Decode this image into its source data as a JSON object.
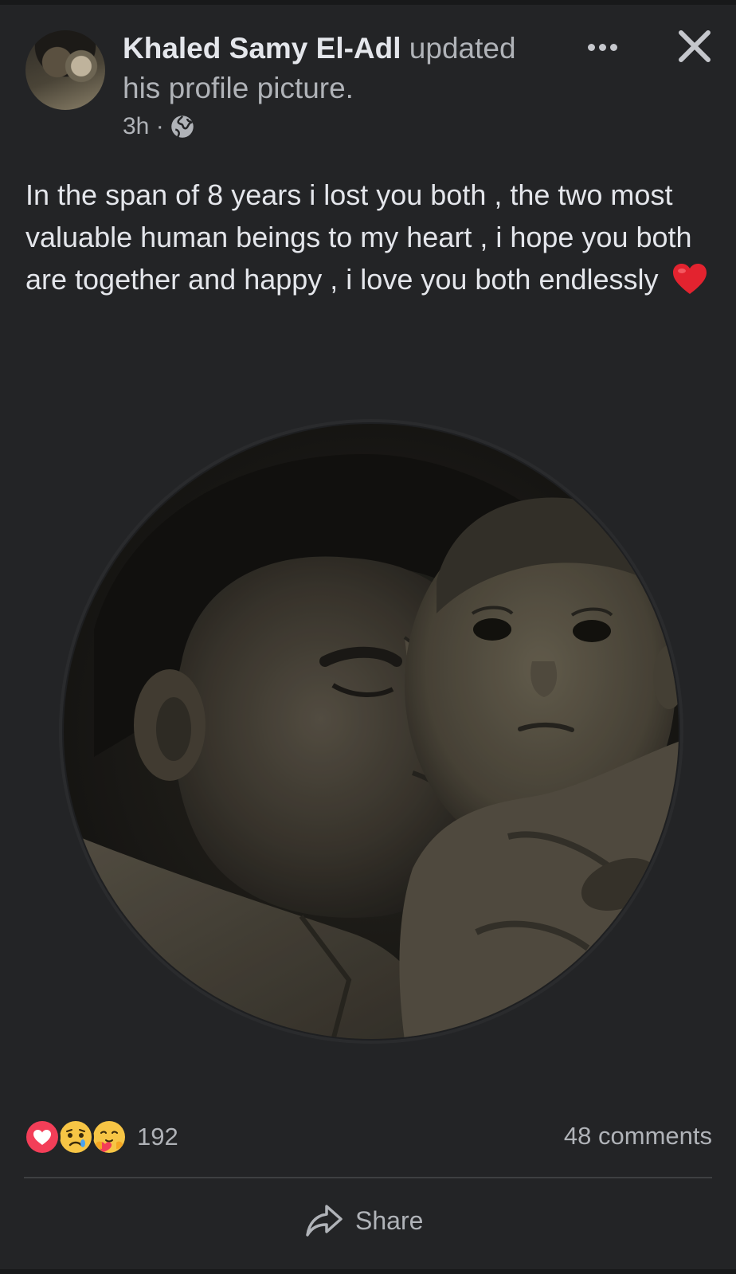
{
  "post": {
    "author": "Khaled Samy El-Adl",
    "action_line1": " updated",
    "action_line2": "his profile picture.",
    "time": "3h ·",
    "privacy_icon": "globe-icon",
    "text": "In the span of 8 years i lost you both , the two most valuable human beings to my heart , i hope you both are together and happy , i love you both endlessly",
    "text_emoji": "heart-emoji"
  },
  "header": {
    "more_icon": "more-options-icon",
    "close_icon": "close-icon"
  },
  "photo": {
    "shape": "circle",
    "description_icon": "profile-photo"
  },
  "footer": {
    "reactions": [
      "love",
      "care-sad",
      "care"
    ],
    "reaction_count": "192",
    "comments": "48 comments",
    "share_label": "Share"
  },
  "colors": {
    "background": "#232426",
    "text_primary": "#e4e6eb",
    "text_secondary": "#b0b3b8",
    "love": "#f33e58",
    "divider": "#3e4042"
  }
}
